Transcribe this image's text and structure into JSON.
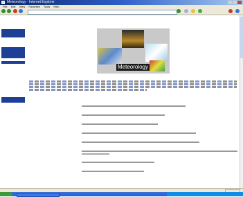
{
  "window": {
    "title": "Meteorology · Internet Explorer",
    "controls": [
      "minimize-icon",
      "maximize-icon",
      "close-icon"
    ]
  },
  "menubar": {
    "items": [
      "File",
      "Edit",
      "View",
      "Favorites",
      "Tools",
      "Help"
    ]
  },
  "toolbar": {
    "back_icon": "back-arrow-icon",
    "forward_icon": "forward-arrow-icon",
    "address": ""
  },
  "sidebar": {
    "logo": "",
    "blocks": [
      {
        "header": "",
        "items": [
          "",
          ""
        ]
      },
      {
        "header": "",
        "items": [
          "",
          "",
          ""
        ]
      },
      {
        "header": "",
        "items": [
          "",
          "",
          "",
          "",
          "",
          "",
          "",
          "",
          ""
        ]
      },
      {
        "header": "",
        "items": [
          "",
          ""
        ]
      }
    ]
  },
  "hero": {
    "banner": "Meteorology",
    "caption": ""
  },
  "index_label": "",
  "sections": [
    {
      "title": ""
    },
    {
      "title": ""
    },
    {
      "title": ""
    },
    {
      "title": ""
    },
    {
      "title": ""
    },
    {
      "title": ""
    },
    {
      "title": ""
    },
    {
      "title": ""
    },
    {
      "title": ""
    }
  ],
  "statusbar": {
    "text": ""
  },
  "taskbar": {
    "start": "",
    "task": "",
    "clock": ""
  },
  "colors": {
    "nav_blue": "#1e3f96",
    "section_red": "#cc0000",
    "titlebar": "#0a246a"
  }
}
